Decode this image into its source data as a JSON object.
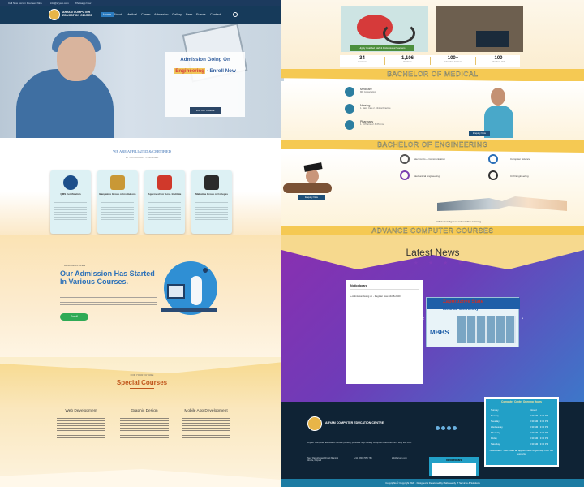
{
  "topbar": {
    "phone": "Call Now Excom Fourteen Nine",
    "email": "info@aryam.com",
    "whatsapp": "Whatsapp Now"
  },
  "brand": {
    "name": "ARYAM COMPUTER EDUCATION CENTRE"
  },
  "nav": {
    "items": [
      "Home",
      "About",
      "Medical",
      "Career",
      "Admission",
      "Gallery",
      "Fees",
      "Events",
      "Contact"
    ]
  },
  "hero": {
    "line1": "Admission Going On",
    "line2_highlight": "Engineering",
    "line2_rest": " - Enroll Now",
    "button": "Visit Our Institute"
  },
  "affiliations": {
    "title": "WE ARE AFFILIATED & CERTIFIED",
    "subtitle": "BY US PROUDLY CERTIFIED",
    "cards": [
      {
        "title": "QMS Certification"
      },
      {
        "title": "Bangalore Group of Institutions"
      },
      {
        "title": "Approved For Govt. Institute"
      },
      {
        "title": "Mahatma Group of Colleges"
      }
    ]
  },
  "admission": {
    "tag": "ADMISSION OPEN",
    "heading": "Our Admission Has Started In Various Courses.",
    "button": "Enroll"
  },
  "special": {
    "tag": "FOR YOUR FUTURE",
    "heading": "Special Courses",
    "courses": [
      {
        "title": "Web Development"
      },
      {
        "title": "Graphic Design"
      },
      {
        "title": "Mobile App Development"
      }
    ]
  },
  "photos": {
    "caption_a": "Highly Qualified Staff & Professional Teachers"
  },
  "stats": [
    {
      "number": "34",
      "label": "Teachers"
    },
    {
      "number": "1,106",
      "label": "Students"
    },
    {
      "number": "100+",
      "label": "Education Courses"
    },
    {
      "number": "100",
      "label": "Members Hub"
    }
  ],
  "medical": {
    "band_title": "BACHELOR OF MEDICAL",
    "items": [
      {
        "label": "Medicare",
        "detail": "MD Consultation"
      },
      {
        "label": "Nursing",
        "detail": "1. Basic Care 2. Clinical Practice"
      },
      {
        "label": "Pharmacy",
        "detail": "1. D.Pharma 2. B.Pharma"
      }
    ],
    "button": "Enquiry Now"
  },
  "engineering": {
    "band_title": "BACHELOR OF ENGINEERING",
    "items": [
      "Electronics & Communication",
      "Computer Science",
      "Mechanical Engineering",
      "Civil Engineering"
    ],
    "button": "Enquiry Now",
    "caption": "Artificial Intelligence and machine learning"
  },
  "computer": {
    "band_title": "ADVANCE COMPUTER COURSES"
  },
  "news": {
    "title": "Latest News",
    "stars": "★ ★ ★ ★ ★",
    "noticeboard_title": "Noticeboard",
    "notice_item": "» Admission Going on - Register Now 19-08-2020",
    "slider_t1": "Zaporozhye State",
    "slider_t2": "Medical University",
    "slider_mbbs": "MBBS"
  },
  "footer": {
    "name": "ARYAM COMPUTER EDUCATION CENTRE",
    "description": "Aryam Computer Education Centre (ACEC) provides high quality computer education at a very low cost.",
    "addr1": "Near Rajanibagan Chowk Manipal Abode, Kotputli",
    "addr2": "+91 9800 7656 765",
    "addr3": "info@aryam.com",
    "noticeboard": "Noticeboard",
    "hours_title": "Computer Center Opening Hours",
    "hours": [
      {
        "day": "Sunday",
        "time": "Closed"
      },
      {
        "day": "Monday",
        "time": "9:30 AM - 3:30 PM"
      },
      {
        "day": "Tuesday",
        "time": "9:30 AM - 3:30 PM"
      },
      {
        "day": "Wednesday",
        "time": "9:30 AM - 3:30 PM"
      },
      {
        "day": "Thursday",
        "time": "9:30 AM - 3:30 PM"
      },
      {
        "day": "Friday",
        "time": "9:30 AM - 3:30 PM"
      },
      {
        "day": "Saturday",
        "time": "9:30 AM - 3:30 PM"
      }
    ],
    "help": "Need Help? Just make an appointment to get help from our experts",
    "copyright": "Copyrights © Copyright 2020 . Designed & Developed by Mahaveerdy IT Services & Solutions"
  }
}
